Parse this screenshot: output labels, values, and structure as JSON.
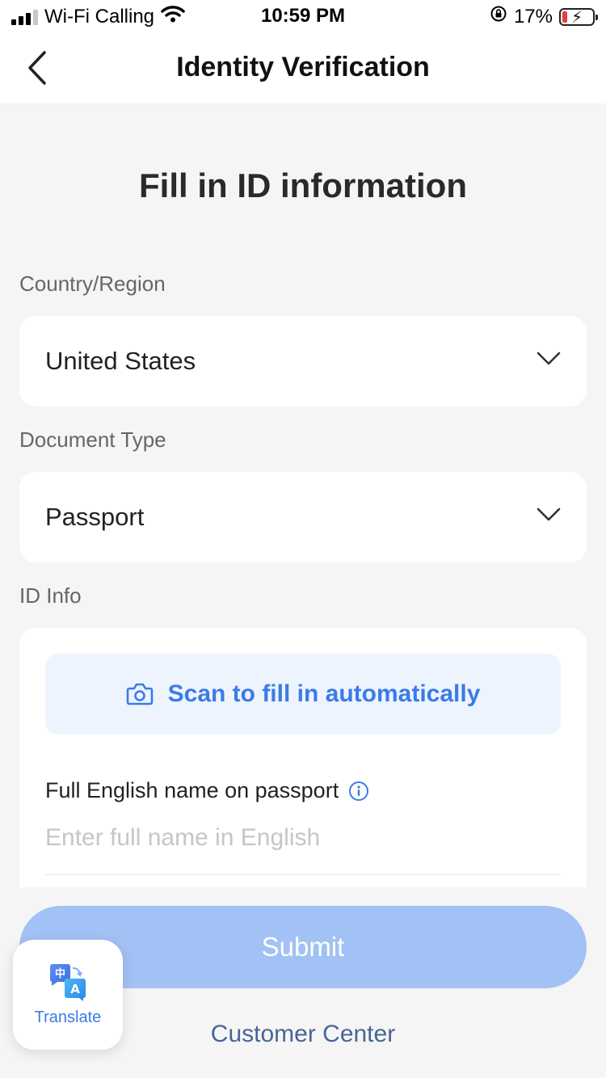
{
  "status_bar": {
    "carrier": "Wi-Fi Calling",
    "time": "10:59 PM",
    "battery": "17%",
    "battery_level": 0.17,
    "icons": [
      "signal-icon",
      "wifi-icon",
      "rotation-lock-icon",
      "battery-charging-icon"
    ]
  },
  "nav": {
    "title": "Identity Verification",
    "back_icon": "chevron-left-icon"
  },
  "main": {
    "headline": "Fill in ID information",
    "country": {
      "label": "Country/Region",
      "value": "United States"
    },
    "document": {
      "label": "Document Type",
      "value": "Passport"
    },
    "id_info": {
      "label": "ID Info",
      "scan_label": "Scan to fill in automatically",
      "scan_icon": "camera-icon",
      "name_label": "Full English name on passport",
      "name_info_icon": "info-icon",
      "name_placeholder": "Enter full name in English",
      "name_value": ""
    }
  },
  "footer": {
    "submit_label": "Submit",
    "customer_center": "Customer Center",
    "translate_label": "Translate",
    "translate_icon_glyphs": [
      "中",
      "A"
    ]
  },
  "colors": {
    "accent": "#3b7be8",
    "submit_disabled": "#a2c1f4",
    "background": "#f5f5f5",
    "link": "#4a6496"
  }
}
